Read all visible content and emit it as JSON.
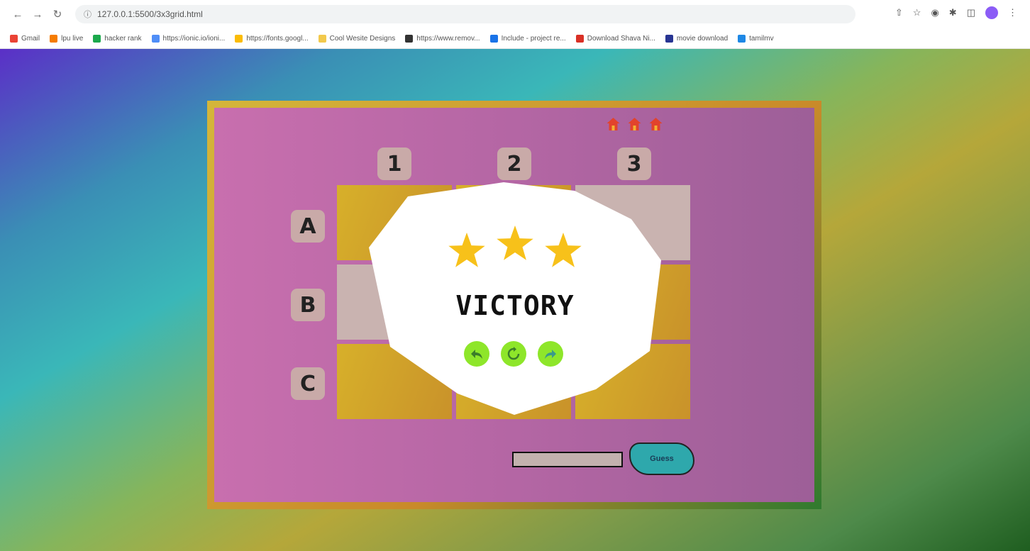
{
  "browser": {
    "url": "127.0.0.1:5500/3x3grid.html",
    "bookmarks": [
      {
        "label": "Gmail",
        "color": "#ea4335"
      },
      {
        "label": "lpu live",
        "color": "#f57c00"
      },
      {
        "label": "hacker rank",
        "color": "#1ba94c"
      },
      {
        "label": "https://ionic.io/ioni...",
        "color": "#4f8ef7"
      },
      {
        "label": "https://fonts.googl...",
        "color": "#fbbc05"
      },
      {
        "label": "Cool Wesite Designs",
        "color": "#f2c94c"
      },
      {
        "label": "https://www.remov...",
        "color": "#333333"
      },
      {
        "label": "Include - project re...",
        "color": "#1a73e8"
      },
      {
        "label": "Download Shava Ni...",
        "color": "#d93025"
      },
      {
        "label": "movie download",
        "color": "#283593"
      },
      {
        "label": "tamilmv",
        "color": "#1e88e5"
      }
    ]
  },
  "game": {
    "lives_count": 3,
    "columns": [
      "1",
      "2",
      "3"
    ],
    "rows": [
      "A",
      "B",
      "C"
    ],
    "guess_button": "Guess",
    "answer_value": ""
  },
  "popup": {
    "stars": 3,
    "title": "VICTORY",
    "controls": [
      "back-icon",
      "replay-icon",
      "next-icon"
    ],
    "button_color": "#8ee62a",
    "star_color": "#f7c11a"
  }
}
